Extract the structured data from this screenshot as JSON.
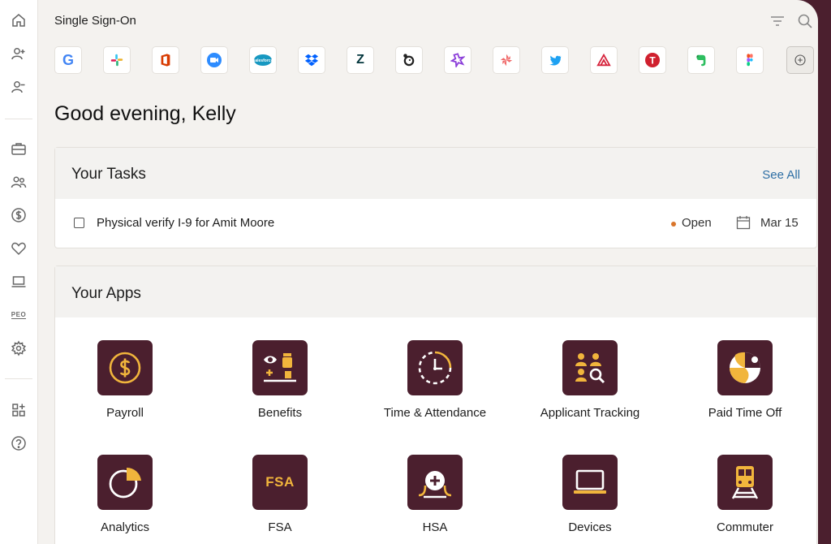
{
  "colors": {
    "brand": "#4b1f2e",
    "accent": "#f1b53c",
    "link": "#2e6fa5",
    "status_open": "#d9752b"
  },
  "sidebar": {
    "items": [
      {
        "icon": "home-icon"
      },
      {
        "icon": "add-person-icon"
      },
      {
        "icon": "remove-person-icon"
      },
      {
        "icon": "briefcase-icon"
      },
      {
        "icon": "people-icon"
      },
      {
        "icon": "dollar-icon"
      },
      {
        "icon": "heart-icon"
      },
      {
        "icon": "laptop-icon"
      },
      {
        "icon": "peo-icon",
        "label": "PEO"
      },
      {
        "icon": "gear-icon"
      },
      {
        "icon": "apps-add-icon"
      },
      {
        "icon": "help-icon"
      }
    ]
  },
  "header": {
    "title": "Single Sign-On",
    "filter_icon": "filter-icon",
    "search_icon": "search-icon"
  },
  "sso_apps": [
    {
      "name": "Google",
      "icon": "google-icon",
      "glyph": "G"
    },
    {
      "name": "Slack",
      "icon": "slack-icon",
      "glyph": "#"
    },
    {
      "name": "Office",
      "icon": "office-icon",
      "glyph": ""
    },
    {
      "name": "Zoom",
      "icon": "zoom-icon",
      "glyph": ""
    },
    {
      "name": "Salesforce",
      "icon": "salesforce-icon",
      "glyph": "salesforce"
    },
    {
      "name": "Dropbox",
      "icon": "dropbox-icon",
      "glyph": ""
    },
    {
      "name": "Zendesk",
      "icon": "zendesk-icon",
      "glyph": "Z"
    },
    {
      "name": "Mailchimp",
      "icon": "mailchimp-icon",
      "glyph": ""
    },
    {
      "name": "Hive",
      "icon": "star-burst-icon",
      "glyph": ""
    },
    {
      "name": "Asana",
      "icon": "pinwheel-icon",
      "glyph": ""
    },
    {
      "name": "Twitter",
      "icon": "twitter-icon",
      "glyph": ""
    },
    {
      "name": "Triangle",
      "icon": "stacked-triangle-icon",
      "glyph": ""
    },
    {
      "name": "T app",
      "icon": "t-circle-icon",
      "glyph": "T"
    },
    {
      "name": "Evernote",
      "icon": "evernote-icon",
      "glyph": ""
    },
    {
      "name": "Figma",
      "icon": "figma-icon",
      "glyph": ""
    },
    {
      "name": "Add",
      "icon": "add-circle-icon",
      "glyph": "+"
    }
  ],
  "greeting": "Good evening, Kelly",
  "tasks": {
    "title": "Your Tasks",
    "see_all": "See All",
    "items": [
      {
        "label": "Physical verify I-9 for Amit Moore",
        "status": "Open",
        "date": "Mar 15"
      }
    ]
  },
  "apps": {
    "title": "Your Apps",
    "items": [
      {
        "label": "Payroll",
        "icon": "payroll-dollar-icon"
      },
      {
        "label": "Benefits",
        "icon": "benefits-icon"
      },
      {
        "label": "Time & Attendance",
        "icon": "clock-icon"
      },
      {
        "label": "Applicant Tracking",
        "icon": "applicant-search-icon"
      },
      {
        "label": "Paid Time Off",
        "icon": "beach-ball-icon"
      },
      {
        "label": "Analytics",
        "icon": "pie-chart-icon"
      },
      {
        "label": "FSA",
        "icon": "fsa-icon",
        "glyph": "FSA"
      },
      {
        "label": "HSA",
        "icon": "hsa-icon"
      },
      {
        "label": "Devices",
        "icon": "laptop-icon"
      },
      {
        "label": "Commuter",
        "icon": "train-icon"
      }
    ]
  }
}
